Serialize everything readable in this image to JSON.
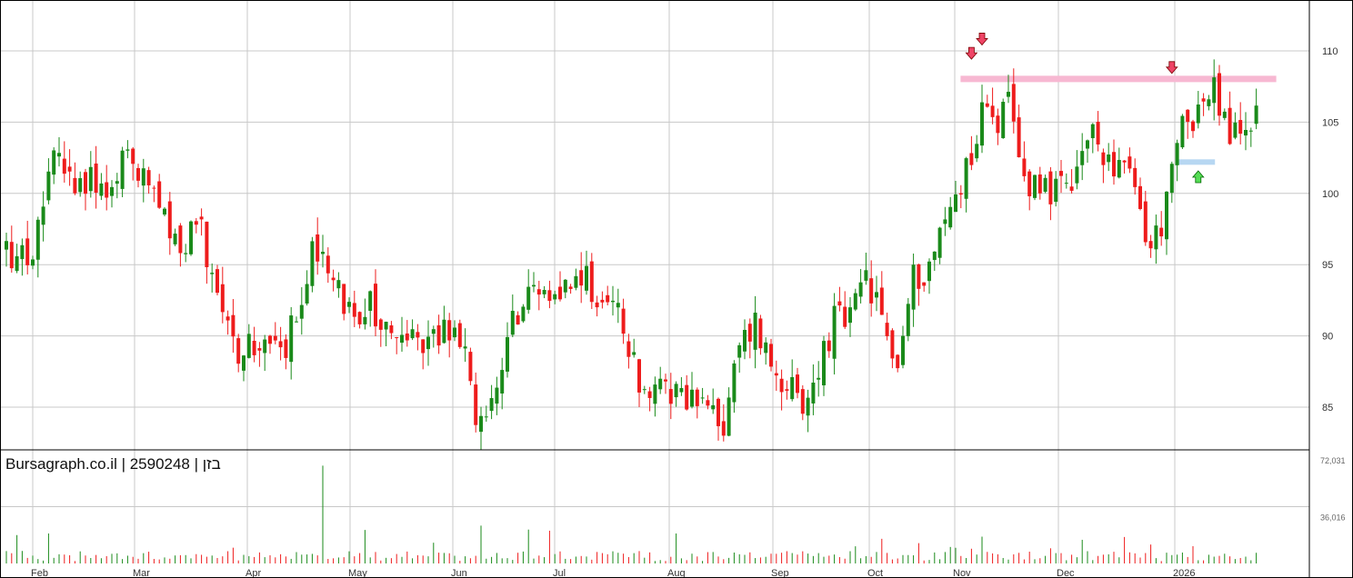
{
  "watermark": "Bursagraph.co.il | 2590248 | בזן",
  "colors": {
    "up": "#1a8a1a",
    "down": "#ee1c1c",
    "grid": "#c8c8c8",
    "resistance": "#f7b8d2",
    "support": "#b7d7f2",
    "marker_down": "#ee4466",
    "marker_up": "#55dd55"
  },
  "chart_data": {
    "type": "candlestick",
    "x_tick_labels": [
      "Feb",
      "Mar",
      "Apr",
      "May",
      "Jun",
      "Jul",
      "Aug",
      "Sep",
      "Oct",
      "Nov",
      "Dec",
      "2026"
    ],
    "price_axis": {
      "ticks": [
        "85",
        "90",
        "95",
        "100",
        "105",
        "110"
      ],
      "range": [
        82,
        112
      ]
    },
    "volume_axis": {
      "ticks": [
        "36,016",
        "72,031"
      ],
      "max": 72031
    },
    "anchors": [
      [
        0,
        96
      ],
      [
        4,
        95
      ],
      [
        9,
        102
      ],
      [
        14,
        101
      ],
      [
        19,
        101
      ],
      [
        23,
        103
      ],
      [
        28,
        100
      ],
      [
        33,
        96
      ],
      [
        36,
        98
      ],
      [
        40,
        94
      ],
      [
        43,
        89
      ],
      [
        48,
        90
      ],
      [
        52,
        89
      ],
      [
        55,
        91
      ],
      [
        58,
        96
      ],
      [
        61,
        95
      ],
      [
        64,
        92
      ],
      [
        66,
        91
      ],
      [
        69,
        92
      ],
      [
        73,
        90
      ],
      [
        77,
        91
      ],
      [
        80,
        89
      ],
      [
        83,
        91
      ],
      [
        86,
        90
      ],
      [
        89,
        85
      ],
      [
        91,
        84
      ],
      [
        94,
        88
      ],
      [
        96,
        91
      ],
      [
        99,
        93
      ],
      [
        103,
        93.5
      ],
      [
        106,
        94
      ],
      [
        109,
        94
      ],
      [
        112,
        93
      ],
      [
        116,
        92
      ],
      [
        118,
        89
      ],
      [
        121,
        85
      ],
      [
        125,
        86
      ],
      [
        128,
        86
      ],
      [
        132,
        85
      ],
      [
        136,
        83.5
      ],
      [
        139,
        89
      ],
      [
        142,
        91
      ],
      [
        145,
        88
      ],
      [
        148,
        87
      ],
      [
        151,
        84
      ],
      [
        154,
        88
      ],
      [
        157,
        91
      ],
      [
        160,
        91
      ],
      [
        163,
        94
      ],
      [
        166,
        91
      ],
      [
        169,
        88
      ],
      [
        172,
        94
      ],
      [
        175,
        95
      ],
      [
        178,
        98
      ],
      [
        181,
        101
      ],
      [
        184,
        104
      ],
      [
        186,
        107
      ],
      [
        188,
        105
      ],
      [
        190,
        106
      ],
      [
        193,
        101
      ],
      [
        196,
        101
      ],
      [
        199,
        100
      ],
      [
        202,
        100
      ],
      [
        205,
        104
      ],
      [
        208,
        103
      ],
      [
        211,
        102
      ],
      [
        214,
        100
      ],
      [
        217,
        96
      ],
      [
        220,
        99
      ],
      [
        223,
        105
      ],
      [
        226,
        106
      ],
      [
        229,
        107
      ],
      [
        232,
        104
      ],
      [
        235,
        104.5
      ],
      [
        237,
        106
      ]
    ],
    "resistance_line": {
      "price": 108
    },
    "support_line": {
      "price": 102.2
    },
    "markers": [
      {
        "type": "down",
        "bar": 183,
        "price": 109.8
      },
      {
        "type": "down",
        "bar": 185,
        "price": 110.8
      },
      {
        "type": "down",
        "bar": 221,
        "price": 108.8
      },
      {
        "type": "up",
        "bar": 226,
        "price": 101.2
      }
    ]
  }
}
